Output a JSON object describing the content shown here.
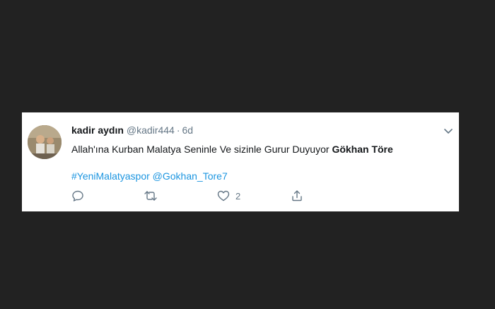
{
  "tweet": {
    "display_name": "kadir aydın",
    "handle": "@kadir444",
    "separator": "·",
    "time": "6d",
    "text_plain": "Allah'ına Kurban Malatya Seninle Ve sizinle Gurur Duyuyor",
    "text_bold": "Gökhan Töre",
    "hashtag": "#YeniMalatyaspor",
    "mention": "@Gokhan_Tore7",
    "reply_icon": "reply-icon",
    "retweet_icon": "retweet-icon",
    "like_icon": "heart-icon",
    "like_count": "2",
    "share_icon": "share-icon",
    "menu_icon": "chevron-down-icon"
  },
  "colors": {
    "background": "#222222",
    "card": "#ffffff",
    "text": "#14171a",
    "muted": "#657786",
    "link": "#1b95e0"
  }
}
